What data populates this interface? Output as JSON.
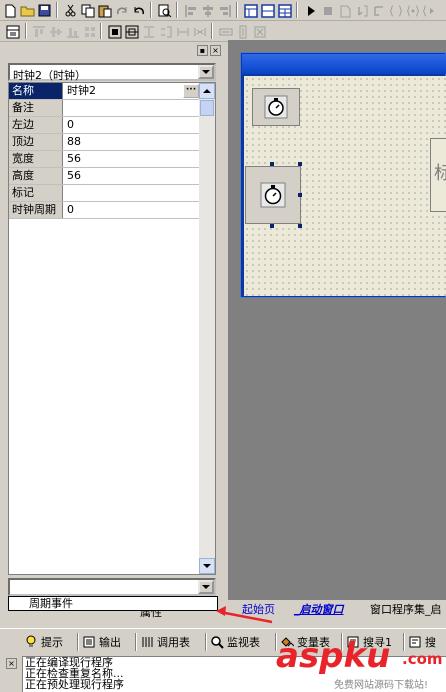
{
  "property_panel": {
    "object_selector": "时钟2（时钟）",
    "properties": [
      {
        "name": "名称",
        "value": "时钟2",
        "selected": true
      },
      {
        "name": "备注",
        "value": ""
      },
      {
        "name": "左边",
        "value": "0"
      },
      {
        "name": "顶边",
        "value": "88"
      },
      {
        "name": "宽度",
        "value": "56"
      },
      {
        "name": "高度",
        "value": "56"
      },
      {
        "name": "标记",
        "value": ""
      },
      {
        "name": "时钟周期",
        "value": "0"
      }
    ],
    "event_option": "周期事件",
    "under_label": "属性"
  },
  "design_area": {
    "cut_label": "标"
  },
  "tabs": {
    "start_page": "起始页",
    "startup_window": "_启动窗口",
    "window_program": "窗口程序集_启"
  },
  "output_tabs": [
    {
      "label": "提示",
      "icon": "bulb-icon"
    },
    {
      "label": "输出",
      "icon": "output-icon"
    },
    {
      "label": "调用表",
      "icon": "call-table-icon"
    },
    {
      "label": "监视表",
      "icon": "magnifier-icon"
    },
    {
      "label": "变量表",
      "icon": "variables-icon"
    },
    {
      "label": "搜寻1",
      "icon": "search1-icon"
    },
    {
      "label": "搜",
      "icon": "search2-icon"
    }
  ],
  "output_lines": [
    "正在编译现行程序",
    "正在检查重复名称...",
    "正在预处理现行程序"
  ],
  "watermark": {
    "brand": "aspku",
    "tld": ".com",
    "tagline": "免费网站源码下载站!"
  },
  "colors": {
    "selection": "#0a246a",
    "title_blue": "#0b43c7",
    "link_blue": "#0000cc",
    "watermark_red": "#e8232a"
  }
}
